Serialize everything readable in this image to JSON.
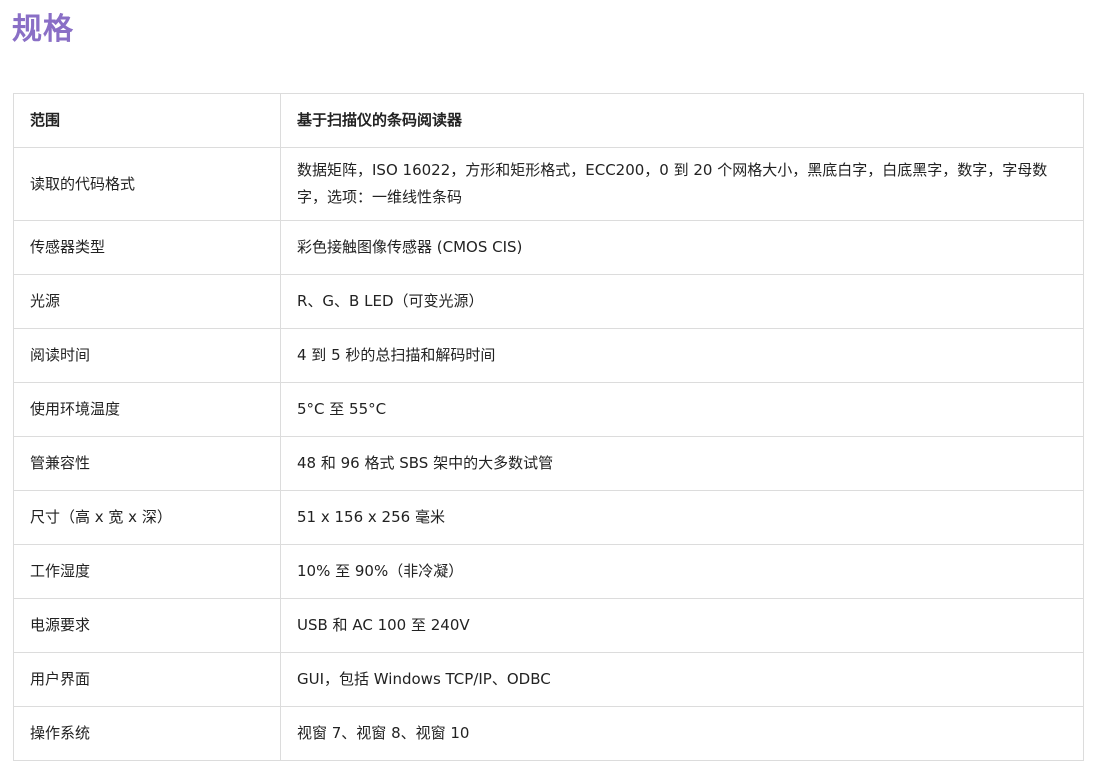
{
  "page": {
    "title": "规格"
  },
  "table": {
    "header": {
      "col1": "范围",
      "col2": "基于扫描仪的条码阅读器"
    },
    "rows": [
      {
        "label": "读取的代码格式",
        "value": "数据矩阵，ISO 16022，方形和矩形格式，ECC200，0 到 20 个网格大小，黑底白字，白底黑字，数字，字母数字，选项：一维线性条码"
      },
      {
        "label": "传感器类型",
        "value": "彩色接触图像传感器 (CMOS CIS)"
      },
      {
        "label": "光源",
        "value": "R、G、B LED（可变光源）"
      },
      {
        "label": "阅读时间",
        "value": "4 到 5 秒的总扫描和解码时间"
      },
      {
        "label": "使用环境温度",
        "value": "5°C 至 55°C"
      },
      {
        "label": "管兼容性",
        "value": "48 和 96 格式 SBS 架中的大多数试管"
      },
      {
        "label": "尺寸（高 x 宽 x 深）",
        "value": "51 x 156 x 256 毫米"
      },
      {
        "label": "工作湿度",
        "value": "10% 至 90%（非冷凝）"
      },
      {
        "label": "电源要求",
        "value": "USB 和 AC 100 至 240V"
      },
      {
        "label": "用户界面",
        "value": "GUI，包括 Windows TCP/IP、ODBC"
      },
      {
        "label": "操作系统",
        "value": "视窗 7、视窗 8、视窗 10"
      }
    ]
  },
  "colors": {
    "title": "#8a6fc6",
    "border": "#dcdcdc",
    "text": "#222222"
  }
}
